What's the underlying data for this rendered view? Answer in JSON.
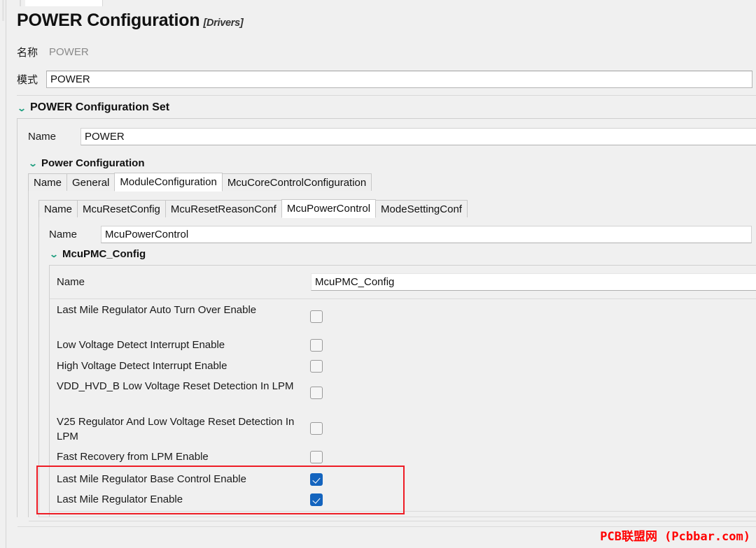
{
  "window": {
    "title": "POWER Configuration",
    "title_suffix": "[Drivers]"
  },
  "header": {
    "name_label": "名称",
    "name_value": "POWER",
    "mode_label": "模式",
    "mode_value": "POWER"
  },
  "config_set": {
    "chevron": "⌄",
    "title": "POWER Configuration Set",
    "name_label": "Name",
    "name_value": "POWER"
  },
  "power_configuration": {
    "chevron": "⌄",
    "title": "Power Configuration",
    "tabs": [
      {
        "label": "Name",
        "selected": false
      },
      {
        "label": "General",
        "selected": false
      },
      {
        "label": "ModuleConfiguration",
        "selected": true
      },
      {
        "label": "McuCoreControlConfiguration",
        "selected": false
      }
    ]
  },
  "module_configuration": {
    "tabs": [
      {
        "label": "Name",
        "selected": false
      },
      {
        "label": "McuResetConfig",
        "selected": false
      },
      {
        "label": "McuResetReasonConf",
        "selected": false
      },
      {
        "label": "McuPowerControl",
        "selected": true
      },
      {
        "label": "ModeSettingConf",
        "selected": false
      }
    ],
    "name_label": "Name",
    "name_value": "McuPowerControl"
  },
  "mcu_pmc_config": {
    "chevron": "⌄",
    "title": "McuPMC_Config",
    "name_label": "Name",
    "name_value": "McuPMC_Config",
    "properties": [
      {
        "label": "Last Mile Regulator Auto Turn Over Enable",
        "checked": false,
        "lines": 2
      },
      {
        "label": "Low Voltage Detect Interrupt Enable",
        "checked": false,
        "lines": 1
      },
      {
        "label": "High Voltage Detect Interrupt Enable",
        "checked": false,
        "lines": 1
      },
      {
        "label": "VDD_HVD_B Low Voltage Reset Detection In LPM",
        "checked": false,
        "lines": 2
      },
      {
        "label": "V25 Regulator And Low Voltage Reset Detection In LPM",
        "checked": false,
        "lines": 2
      },
      {
        "label": "Fast Recovery from LPM Enable",
        "checked": false,
        "lines": 1
      },
      {
        "label": "Last Mile Regulator Base Control Enable",
        "checked": true,
        "lines": 1
      },
      {
        "label": "Last Mile Regulator Enable",
        "checked": true,
        "lines": 1
      }
    ]
  },
  "annotation": {
    "highlight_color": "#ee1c25",
    "highlighted_rows": [
      "Last Mile Regulator Base Control Enable",
      "Last Mile Regulator Enable"
    ]
  },
  "watermark": {
    "text": "PCB联盟网 (Pcbbar.com)",
    "color": "#ff0000"
  }
}
